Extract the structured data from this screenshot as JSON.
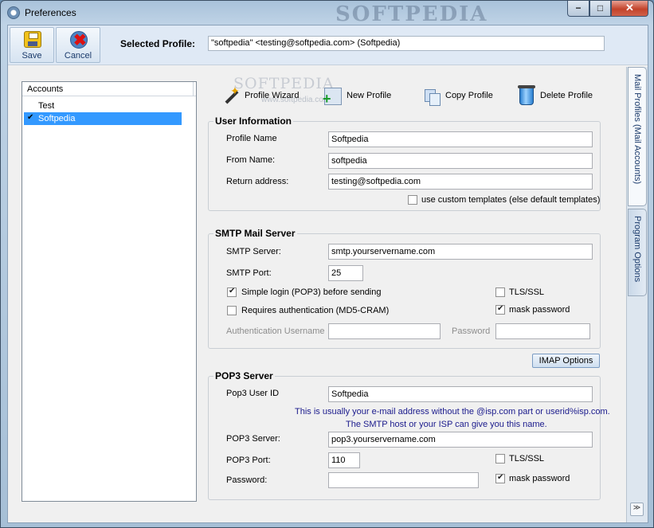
{
  "window": {
    "title": "Preferences",
    "watermark": "SOFTPEDIA",
    "min_glyph": "−",
    "max_glyph": "□",
    "close_glyph": "✕"
  },
  "toolbar": {
    "save_label": "Save",
    "cancel_label": "Cancel",
    "selected_profile_label": "Selected Profile:",
    "selected_profile_value": "\"softpedia\" <testing@softpedia.com> (Softpedia)"
  },
  "accounts": {
    "header": "Accounts",
    "items": [
      {
        "label": "Test",
        "checked": false,
        "selected": false
      },
      {
        "label": "Softpedia",
        "checked": true,
        "selected": true
      }
    ]
  },
  "actions": {
    "wizard": "Profile Wizard",
    "new": "New Profile",
    "copy": "Copy Profile",
    "delete": "Delete Profile"
  },
  "watermark_center": {
    "text": "SOFTPEDIA",
    "sub": "www.softpedia.com"
  },
  "user_info": {
    "title": "User Information",
    "profile_name_label": "Profile Name",
    "profile_name_value": "Softpedia",
    "from_name_label": "From Name:",
    "from_name_value": "softpedia",
    "return_label": "Return address:",
    "return_value": "testing@softpedia.com",
    "custom_templates_label": "use custom templates (else default templates)",
    "custom_templates_checked": false
  },
  "smtp": {
    "title": "SMTP Mail Server",
    "server_label": "SMTP Server:",
    "server_value": "smtp.yourservername.com",
    "port_label": "SMTP Port:",
    "port_value": "25",
    "simple_login_label": "Simple login (POP3) before sending",
    "simple_login_checked": true,
    "requires_auth_label": "Requires authentication (MD5-CRAM)",
    "requires_auth_checked": false,
    "tls_label": "TLS/SSL",
    "tls_checked": false,
    "mask_label": "mask password",
    "mask_checked": true,
    "auth_user_label": "Authentication Username",
    "auth_user_value": "",
    "password_label": "Password",
    "password_value": ""
  },
  "imap_button": "IMAP Options",
  "pop3": {
    "title": "POP3 Server",
    "user_label": "Pop3 User ID",
    "user_value": "Softpedia",
    "note_line1": "This is usually your e-mail address without the @isp.com part or userid%isp.com.",
    "note_line2": "The SMTP host or your ISP can give you this name.",
    "server_label": "POP3 Server:",
    "server_value": "pop3.yourservername.com",
    "port_label": "POP3 Port:",
    "port_value": "110",
    "tls_label": "TLS/SSL",
    "tls_checked": false,
    "password_label": "Password:",
    "password_value": "",
    "mask_label": "mask password",
    "mask_checked": true
  },
  "tabs": {
    "mail": "Mail Profiles (Mail Accounts)",
    "program": "Program Options",
    "scroll_glyph": "≫"
  },
  "colors": {
    "selection": "#3399ff",
    "close_button": "#c2432b",
    "note_text": "#1a1a8c"
  }
}
